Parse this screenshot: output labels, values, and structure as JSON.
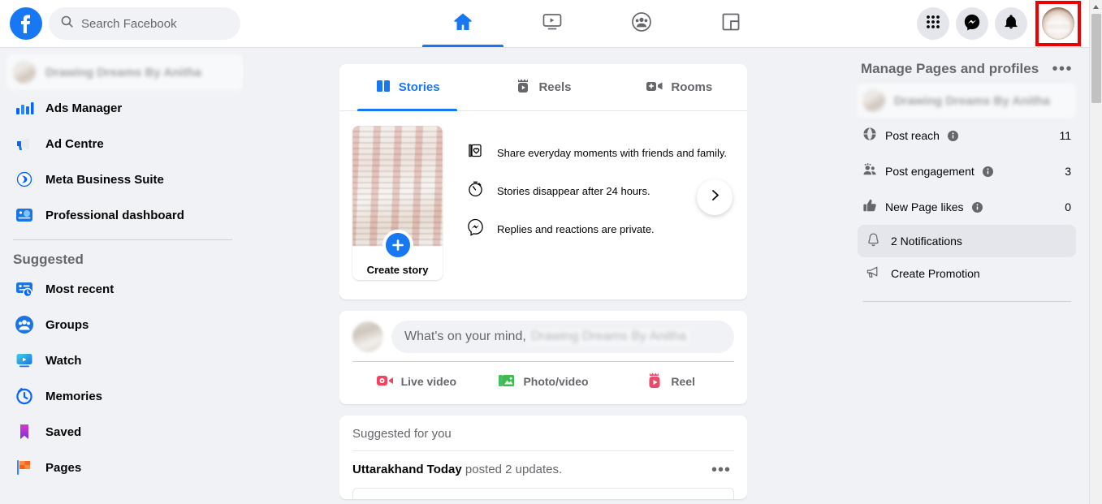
{
  "topbar": {
    "logo_icon": "facebook-logo-icon",
    "search": {
      "placeholder": "Search Facebook",
      "icon": "search-icon"
    },
    "nav": [
      {
        "name": "home",
        "icon": "home-icon",
        "active": true
      },
      {
        "name": "video",
        "icon": "video-icon",
        "active": false
      },
      {
        "name": "groups",
        "icon": "groups-icon",
        "active": false
      },
      {
        "name": "gaming",
        "icon": "gaming-icon",
        "active": false
      }
    ],
    "actions": [
      {
        "name": "menu",
        "icon": "grid-menu-icon"
      },
      {
        "name": "messenger",
        "icon": "messenger-icon"
      },
      {
        "name": "notifications",
        "icon": "bell-icon"
      }
    ],
    "account": {
      "name": "account-avatar",
      "highlight_color": "#ee0000"
    }
  },
  "sidebar": {
    "profile": {
      "label": "Drawing Dreams By Anitha",
      "blurred": true
    },
    "items": [
      {
        "label": "Ads Manager",
        "icon": "ads-manager-icon"
      },
      {
        "label": "Ad Centre",
        "icon": "ad-centre-icon"
      },
      {
        "label": "Meta Business Suite",
        "icon": "meta-business-suite-icon"
      },
      {
        "label": "Professional dashboard",
        "icon": "professional-dashboard-icon"
      }
    ],
    "suggested_heading": "Suggested",
    "suggested": [
      {
        "label": "Most recent",
        "icon": "most-recent-icon"
      },
      {
        "label": "Groups",
        "icon": "groups-icon"
      },
      {
        "label": "Watch",
        "icon": "watch-icon"
      },
      {
        "label": "Memories",
        "icon": "memories-icon"
      },
      {
        "label": "Saved",
        "icon": "saved-icon"
      },
      {
        "label": "Pages",
        "icon": "pages-icon"
      }
    ]
  },
  "feed": {
    "story_tabs": [
      {
        "label": "Stories",
        "icon": "stories-icon",
        "active": true
      },
      {
        "label": "Reels",
        "icon": "reels-icon",
        "active": false
      },
      {
        "label": "Rooms",
        "icon": "rooms-icon",
        "active": false
      }
    ],
    "create_story": {
      "label": "Create story",
      "icon": "plus-icon"
    },
    "story_points": [
      {
        "text": "Share everyday moments with friends and family.",
        "icon": "photo-heart-icon"
      },
      {
        "text": "Stories disappear after 24 hours.",
        "icon": "stopwatch-icon"
      },
      {
        "text": "Replies and reactions are private.",
        "icon": "messenger-outline-icon"
      }
    ],
    "next_arrow_icon": "chevron-right-icon",
    "composer": {
      "prompt": "What's on your mind,",
      "page_name": "Drawing Dreams By Anitha",
      "actions": [
        {
          "label": "Live video",
          "icon": "live-video-icon",
          "color": "#f3425f"
        },
        {
          "label": "Photo/video",
          "icon": "photo-video-icon",
          "color": "#45bd62"
        },
        {
          "label": "Reel",
          "icon": "reel-icon",
          "color": "#e84c6b"
        }
      ]
    },
    "suggested": {
      "title": "Suggested for you",
      "post_author": "Uttarakhand Today",
      "post_text": " posted 2 updates.",
      "menu_icon": "more-options-icon",
      "dots": "•••"
    }
  },
  "rightpanel": {
    "title": "Manage Pages and profiles",
    "menu_icon": "more-options-icon",
    "dots": "•••",
    "page": {
      "name": "Drawing Dreams By Anitha",
      "blurred": true
    },
    "stats": [
      {
        "label": "Post reach",
        "value": "11",
        "icon": "globe-icon",
        "info_icon": "info-icon"
      },
      {
        "label": "Post engagement",
        "value": "3",
        "icon": "people-icon",
        "info_icon": "info-icon"
      },
      {
        "label": "New Page likes",
        "value": "0",
        "icon": "thumbs-up-icon",
        "info_icon": "info-icon"
      }
    ],
    "links": [
      {
        "label": "2 Notifications",
        "icon": "bell-outline-icon",
        "highlighted": true
      },
      {
        "label": "Create Promotion",
        "icon": "megaphone-icon",
        "highlighted": false
      }
    ]
  },
  "scrollbar": {
    "up_icon": "scroll-up-arrow-icon"
  },
  "colors": {
    "accent": "#1877f2",
    "bg": "#f0f2f5",
    "card": "#ffffff",
    "highlight": "#ee0000"
  }
}
